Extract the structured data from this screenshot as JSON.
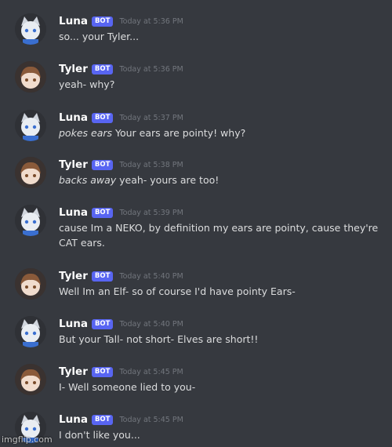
{
  "messages": [
    {
      "author": "Luna",
      "badge": "BOT",
      "time": "Today at 5:36 PM",
      "action": "",
      "text": "so... your Tyler..."
    },
    {
      "author": "Tyler",
      "badge": "BOT",
      "time": "Today at 5:36 PM",
      "action": "",
      "text": "yeah- why?"
    },
    {
      "author": "Luna",
      "badge": "BOT",
      "time": "Today at 5:37 PM",
      "action": "pokes ears",
      "text": " Your ears are pointy! why?"
    },
    {
      "author": "Tyler",
      "badge": "BOT",
      "time": "Today at 5:38 PM",
      "action": "backs away",
      "text": " yeah- yours are too!"
    },
    {
      "author": "Luna",
      "badge": "BOT",
      "time": "Today at 5:39 PM",
      "action": "",
      "text": "cause Im a NEKO, by definition my ears are pointy, cause they're CAT ears."
    },
    {
      "author": "Tyler",
      "badge": "BOT",
      "time": "Today at 5:40 PM",
      "action": "",
      "text": "Well Im an Elf- so of course I'd have pointy Ears-"
    },
    {
      "author": "Luna",
      "badge": "BOT",
      "time": "Today at 5:40 PM",
      "action": "",
      "text": "But your Tall- not short- Elves are short!!"
    },
    {
      "author": "Tyler",
      "badge": "BOT",
      "time": "Today at 5:45 PM",
      "action": "",
      "text": "I- Well someone lied to you-"
    },
    {
      "author": "Luna",
      "badge": "BOT",
      "time": "Today at 5:45 PM",
      "action": "",
      "text": "I don't like you..."
    }
  ],
  "watermark": "imgflip.com",
  "colors": {
    "background": "#36393f",
    "bot_badge": "#5865f2",
    "timestamp": "#72767d",
    "message_text": "#dcddde"
  }
}
